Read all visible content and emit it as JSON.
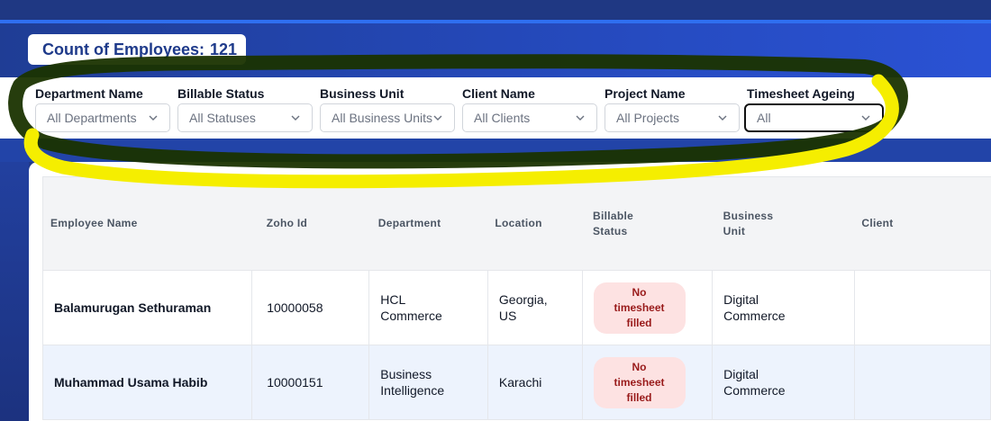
{
  "header": {
    "count_label": "Count of Employees:",
    "count_value": "121"
  },
  "filters": [
    {
      "label": "Department Name",
      "value": "All Departments"
    },
    {
      "label": "Billable Status",
      "value": "All Statuses"
    },
    {
      "label": "Business Unit",
      "value": "All Business Units"
    },
    {
      "label": "Client Name",
      "value": "All Clients"
    },
    {
      "label": "Project Name",
      "value": "All Projects"
    },
    {
      "label": "Timesheet Ageing",
      "value": "All"
    }
  ],
  "table": {
    "columns": [
      "Employee Name",
      "Zoho Id",
      "Department",
      "Location",
      "Billable Status",
      "Business Unit",
      "Client"
    ],
    "rows": [
      {
        "name": "Balamurugan Sethuraman",
        "zoho_id": "10000058",
        "department": "HCL Commerce",
        "location": "Georgia, US",
        "billable_status": "No timesheet filled",
        "business_unit": "Digital Commerce",
        "client": ""
      },
      {
        "name": "Muhammad Usama Habib",
        "zoho_id": "10000151",
        "department": "Business Intelligence",
        "location": "Karachi",
        "billable_status": "No timesheet filled",
        "business_unit": "Digital Commerce",
        "client": ""
      }
    ]
  },
  "colors": {
    "brand_blue": "#1e3a8a",
    "badge_bg": "#fde2e2",
    "badge_text": "#991b1b",
    "annotation_yellow": "#f5ee00",
    "annotation_dark": "#1a3300"
  },
  "icons": [
    "chevron-down-icon"
  ]
}
